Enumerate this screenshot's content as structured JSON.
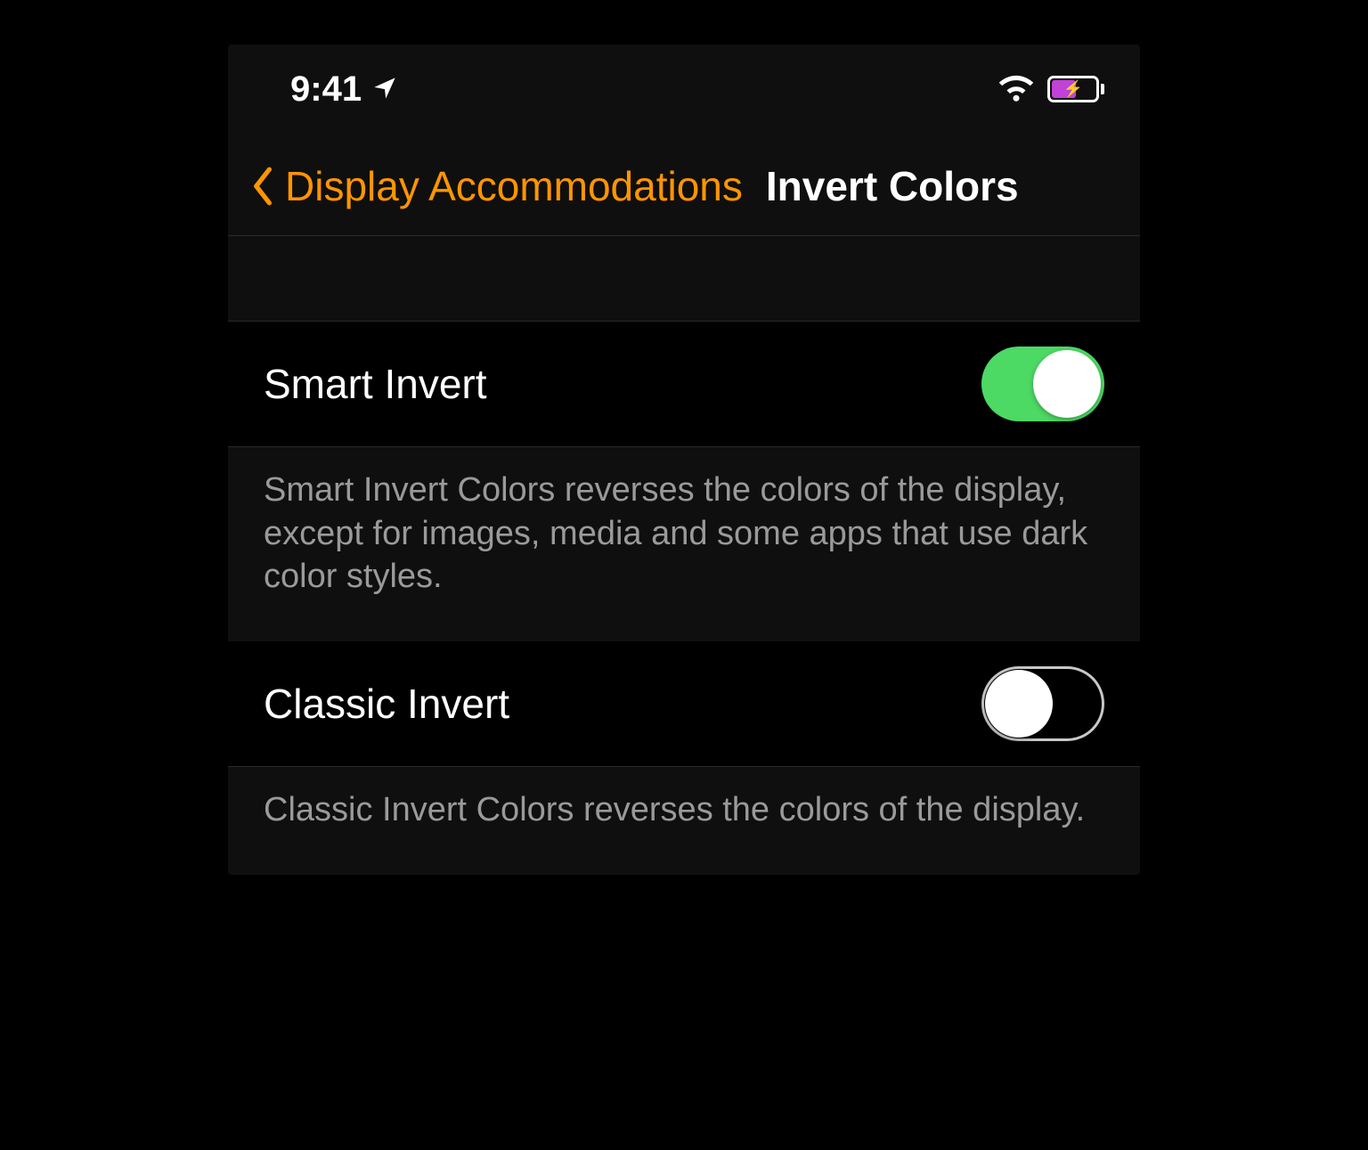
{
  "status_bar": {
    "time": "9:41"
  },
  "nav": {
    "back_label": "Display Accommodations",
    "title": "Invert Colors"
  },
  "settings": [
    {
      "label": "Smart Invert",
      "enabled": true,
      "description": "Smart Invert Colors reverses the colors of the display, except for images, media and some apps that use dark color styles."
    },
    {
      "label": "Classic Invert",
      "enabled": false,
      "description": "Classic Invert Colors reverses the colors of the display."
    }
  ],
  "colors": {
    "accent": "#ff9500",
    "toggle_on": "#4cd964",
    "battery_fill": "#c241d6"
  }
}
